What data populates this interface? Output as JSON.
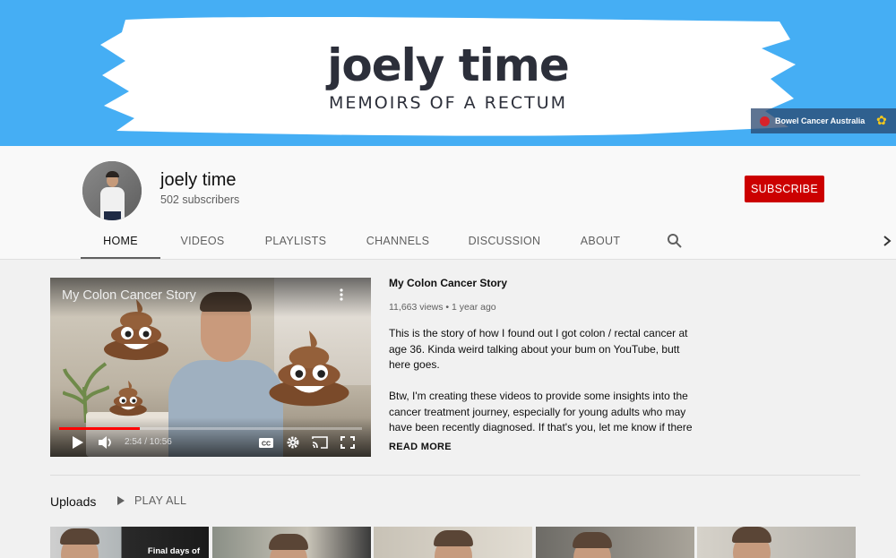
{
  "banner": {
    "title": "joely time",
    "subtitle": "MEMOIRS OF A RECTUM",
    "link_label": "Bowel Cancer Australia",
    "brush_color": "#ffffff",
    "bg_color": "#45aef4"
  },
  "channel": {
    "name": "joely time",
    "subscribers": "502 subscribers",
    "subscribe_label": "SUBSCRIBE",
    "subscribe_color": "#cc0000"
  },
  "tabs": [
    {
      "label": "HOME",
      "active": true
    },
    {
      "label": "VIDEOS",
      "active": false
    },
    {
      "label": "PLAYLISTS",
      "active": false
    },
    {
      "label": "CHANNELS",
      "active": false
    },
    {
      "label": "DISCUSSION",
      "active": false
    },
    {
      "label": "ABOUT",
      "active": false
    }
  ],
  "icons": {
    "search": "search-icon",
    "next": "chevron-right-icon",
    "play": "play-icon",
    "volume": "volume-icon",
    "captions": "cc-icon",
    "settings": "gear-icon",
    "cast": "cast-icon",
    "fullscreen": "fullscreen-icon",
    "menu": "more-vert-icon"
  },
  "featured": {
    "player_title": "My Colon Cancer Story",
    "time": "2:54 / 10:56",
    "progress_fraction": 0.265,
    "title": "My Colon Cancer Story",
    "meta": "11,663 views • 1 year ago",
    "description_1": "This is the story of how I found out I got colon / rectal cancer at age 36. Kinda weird talking about your bum on YouTube, butt here goes.",
    "description_2": "Btw, I'm creating these videos to provide some insights into the cancer treatment journey, especially for young adults who may have been recently diagnosed. If that's you, let me know if there",
    "read_more": "READ MORE"
  },
  "uploads": {
    "heading": "Uploads",
    "play_all": "PLAY ALL",
    "thumbnails": [
      {
        "caption": "Final days of"
      },
      {
        "caption": ""
      },
      {
        "caption": ""
      },
      {
        "caption": ""
      },
      {
        "caption": ""
      }
    ]
  }
}
